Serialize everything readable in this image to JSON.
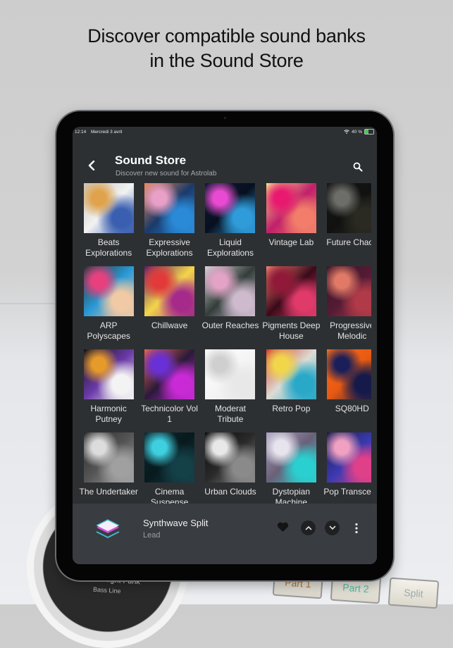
{
  "headline": {
    "line1": "Discover compatible sound banks",
    "line2": "in the Sound Store"
  },
  "background_device": {
    "knob_text": "Midnight Funk",
    "knob_sub": "Bass Line",
    "pads": [
      "Part 1",
      "Part 2",
      "Split"
    ]
  },
  "status_bar": {
    "time": "12:14",
    "date": "Mercredi 3 avril",
    "battery_text": "40 %",
    "battery_level": 0.4,
    "battery_color": "#3ecf4a"
  },
  "header": {
    "back_icon": "chevron-left-icon",
    "title": "Sound Store",
    "subtitle": "Discover new sound for Astrolab",
    "search_icon": "search-icon"
  },
  "sound_banks": [
    {
      "label": "Beats Explorations",
      "colors": [
        "#c9c2b8",
        "#3a5fb0",
        "#e0a24a",
        "#f2f2f2"
      ]
    },
    {
      "label": "Expressive Explorations",
      "colors": [
        "#f08a5a",
        "#2a8ad8",
        "#e9a0c8",
        "#1a3a6a"
      ]
    },
    {
      "label": "Liquid Explorations",
      "colors": [
        "#0b1a36",
        "#2f9bd9",
        "#e84bd1",
        "#08101f"
      ]
    },
    {
      "label": "Vintage Lab",
      "colors": [
        "#f9e08a",
        "#f27d6a",
        "#e8196f",
        "#c0206a"
      ]
    },
    {
      "label": "Future Chaos",
      "colors": [
        "#161613",
        "#2a2a22",
        "#6d6e6a",
        "#111"
      ]
    },
    {
      "label": "ARP Polyscapes",
      "colors": [
        "#2b2b2b",
        "#f0c9a5",
        "#e8407e",
        "#2a9ad6"
      ]
    },
    {
      "label": "Chillwave",
      "colors": [
        "#5b1a6a",
        "#a52a8a",
        "#e23a3a",
        "#f3d54a"
      ]
    },
    {
      "label": "Outer Reaches",
      "colors": [
        "#d8d6dc",
        "#cdbacd",
        "#e4a3c6",
        "#333d3a"
      ]
    },
    {
      "label": "Pigments Deep House",
      "colors": [
        "#f5816e",
        "#e03a6a",
        "#901838",
        "#3a0a1a"
      ]
    },
    {
      "label": "Progressive Melodic",
      "colors": [
        "#3b1626",
        "#b03a48",
        "#e07a66",
        "#541b35"
      ]
    },
    {
      "label": "Harmonic Putney",
      "colors": [
        "#111",
        "#f3f3f3",
        "#e59a2a",
        "#6b3aa8"
      ]
    },
    {
      "label": "Technicolor Vol 1",
      "colors": [
        "#f0644a",
        "#c92ad6",
        "#6a30d8",
        "#2a1a3a"
      ]
    },
    {
      "label": "Moderat Tribute",
      "colors": [
        "#ffffff",
        "#e8e8e8",
        "#cfcfcf",
        "#f5f5f5"
      ]
    },
    {
      "label": "Retro Pop",
      "colors": [
        "#d43a2a",
        "#2aa8c8",
        "#f2d64a",
        "#dcdcd4"
      ]
    },
    {
      "label": "SQ80HD",
      "colors": [
        "#f46a1a",
        "#151a4a",
        "#1a1f5a",
        "#e85a12"
      ]
    },
    {
      "label": "The Undertaker",
      "colors": [
        "#2a2a2a",
        "#a0a0a0",
        "#dcdcdc",
        "#555"
      ]
    },
    {
      "label": "Cinema Suspense",
      "colors": [
        "#0c2a30",
        "#144048",
        "#3fd0e0",
        "#081a1e"
      ]
    },
    {
      "label": "Urban Clouds",
      "colors": [
        "#0a0a0a",
        "#8a8a8a",
        "#e8e8e8",
        "#2a2a2a"
      ]
    },
    {
      "label": "Dystopian Machine",
      "colors": [
        "#a8a0c0",
        "#2ad0d0",
        "#e8e4ee",
        "#6a6078"
      ]
    },
    {
      "label": "Pop Transcend",
      "colors": [
        "#1a1a4a",
        "#e0408a",
        "#f0a0c0",
        "#3a3ab0"
      ]
    }
  ],
  "player": {
    "logo_icon": "stacked-layers-icon",
    "preset_name": "Synthwave Split",
    "preset_category": "Lead",
    "heart_icon": "heart-icon",
    "up_icon": "chevron-up-icon",
    "down_icon": "chevron-down-icon",
    "more_icon": "more-vertical-icon"
  }
}
